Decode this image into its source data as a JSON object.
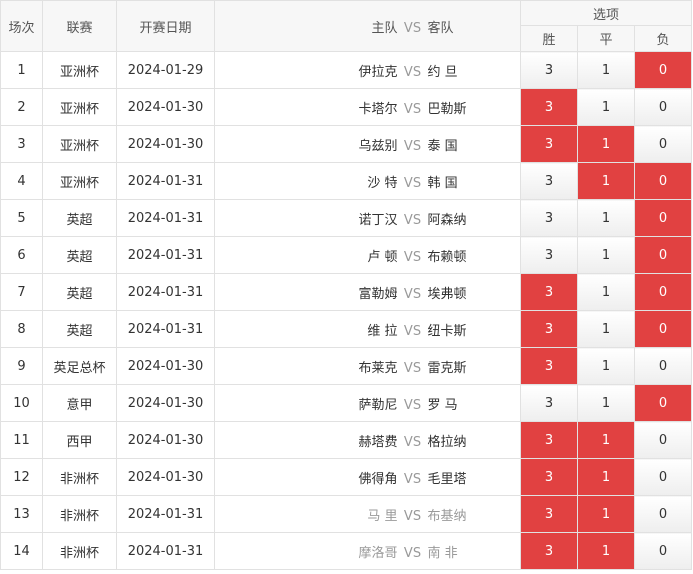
{
  "headers": {
    "round": "场次",
    "league": "联赛",
    "date": "开赛日期",
    "home": "主队",
    "vs": "VS",
    "away": "客队",
    "options": "选项",
    "win": "胜",
    "draw": "平",
    "lose": "负"
  },
  "rows": [
    {
      "no": "1",
      "league": "亚洲杯",
      "date": "2024-01-29",
      "home": "伊拉克",
      "vs": "VS",
      "away": "约 旦",
      "w": "3",
      "d": "1",
      "l": "0",
      "sel": [
        false,
        false,
        true
      ],
      "muted": false
    },
    {
      "no": "2",
      "league": "亚洲杯",
      "date": "2024-01-30",
      "home": "卡塔尔",
      "vs": "VS",
      "away": "巴勒斯",
      "w": "3",
      "d": "1",
      "l": "0",
      "sel": [
        true,
        false,
        false
      ],
      "muted": false
    },
    {
      "no": "3",
      "league": "亚洲杯",
      "date": "2024-01-30",
      "home": "乌兹别",
      "vs": "VS",
      "away": "泰 国",
      "w": "3",
      "d": "1",
      "l": "0",
      "sel": [
        true,
        true,
        false
      ],
      "muted": false
    },
    {
      "no": "4",
      "league": "亚洲杯",
      "date": "2024-01-31",
      "home": "沙 特",
      "vs": "VS",
      "away": "韩 国",
      "w": "3",
      "d": "1",
      "l": "0",
      "sel": [
        false,
        true,
        true
      ],
      "muted": false
    },
    {
      "no": "5",
      "league": "英超",
      "date": "2024-01-31",
      "home": "诺丁汉",
      "vs": "VS",
      "away": "阿森纳",
      "w": "3",
      "d": "1",
      "l": "0",
      "sel": [
        false,
        false,
        true
      ],
      "muted": false
    },
    {
      "no": "6",
      "league": "英超",
      "date": "2024-01-31",
      "home": "卢 顿",
      "vs": "VS",
      "away": "布赖顿",
      "w": "3",
      "d": "1",
      "l": "0",
      "sel": [
        false,
        false,
        true
      ],
      "muted": false
    },
    {
      "no": "7",
      "league": "英超",
      "date": "2024-01-31",
      "home": "富勒姆",
      "vs": "VS",
      "away": "埃弗顿",
      "w": "3",
      "d": "1",
      "l": "0",
      "sel": [
        true,
        false,
        true
      ],
      "muted": false
    },
    {
      "no": "8",
      "league": "英超",
      "date": "2024-01-31",
      "home": "维 拉",
      "vs": "VS",
      "away": "纽卡斯",
      "w": "3",
      "d": "1",
      "l": "0",
      "sel": [
        true,
        false,
        true
      ],
      "muted": false
    },
    {
      "no": "9",
      "league": "英足总杯",
      "date": "2024-01-30",
      "home": "布莱克",
      "vs": "VS",
      "away": "雷克斯",
      "w": "3",
      "d": "1",
      "l": "0",
      "sel": [
        true,
        false,
        false
      ],
      "muted": false
    },
    {
      "no": "10",
      "league": "意甲",
      "date": "2024-01-30",
      "home": "萨勒尼",
      "vs": "VS",
      "away": "罗 马",
      "w": "3",
      "d": "1",
      "l": "0",
      "sel": [
        false,
        false,
        true
      ],
      "muted": false
    },
    {
      "no": "11",
      "league": "西甲",
      "date": "2024-01-30",
      "home": "赫塔费",
      "vs": "VS",
      "away": "格拉纳",
      "w": "3",
      "d": "1",
      "l": "0",
      "sel": [
        true,
        true,
        false
      ],
      "muted": false
    },
    {
      "no": "12",
      "league": "非洲杯",
      "date": "2024-01-30",
      "home": "佛得角",
      "vs": "VS",
      "away": "毛里塔",
      "w": "3",
      "d": "1",
      "l": "0",
      "sel": [
        true,
        true,
        false
      ],
      "muted": false
    },
    {
      "no": "13",
      "league": "非洲杯",
      "date": "2024-01-31",
      "home": "马 里",
      "vs": "VS",
      "away": "布基纳",
      "w": "3",
      "d": "1",
      "l": "0",
      "sel": [
        true,
        true,
        false
      ],
      "muted": true
    },
    {
      "no": "14",
      "league": "非洲杯",
      "date": "2024-01-31",
      "home": "摩洛哥",
      "vs": "VS",
      "away": "南 非",
      "w": "3",
      "d": "1",
      "l": "0",
      "sel": [
        true,
        true,
        false
      ],
      "muted": true
    }
  ],
  "colors": {
    "selected": "#e14141",
    "border": "#e1e1e1",
    "header_bg": "#f7f7f7"
  }
}
